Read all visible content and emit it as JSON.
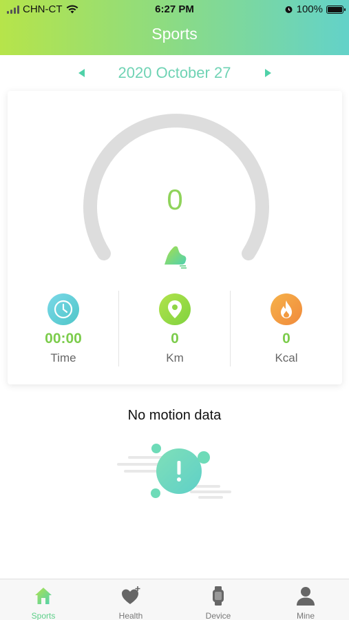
{
  "status_bar": {
    "carrier": "CHN-CT",
    "time": "6:27 PM",
    "battery": "100%"
  },
  "header": {
    "title": "Sports"
  },
  "date_nav": {
    "date": "2020 October 27"
  },
  "gauge": {
    "value": "0"
  },
  "stats": {
    "time": {
      "value": "00:00",
      "label": "Time"
    },
    "distance": {
      "value": "0",
      "label": "Km"
    },
    "calories": {
      "value": "0",
      "label": "Kcal"
    }
  },
  "empty_state": {
    "message": "No motion data"
  },
  "tabbar": {
    "tabs": [
      {
        "label": "Sports",
        "icon": "home-icon",
        "active": true
      },
      {
        "label": "Health",
        "icon": "heart-plus-icon",
        "active": false
      },
      {
        "label": "Device",
        "icon": "watch-icon",
        "active": false
      },
      {
        "label": "Mine",
        "icon": "person-icon",
        "active": false
      }
    ]
  },
  "colors": {
    "accent": "#5ccf88",
    "header_gradient_start": "#b6e44a",
    "header_gradient_end": "#63d2c9",
    "gauge_track": "#dddddd",
    "value_green": "#7ccc4c"
  }
}
